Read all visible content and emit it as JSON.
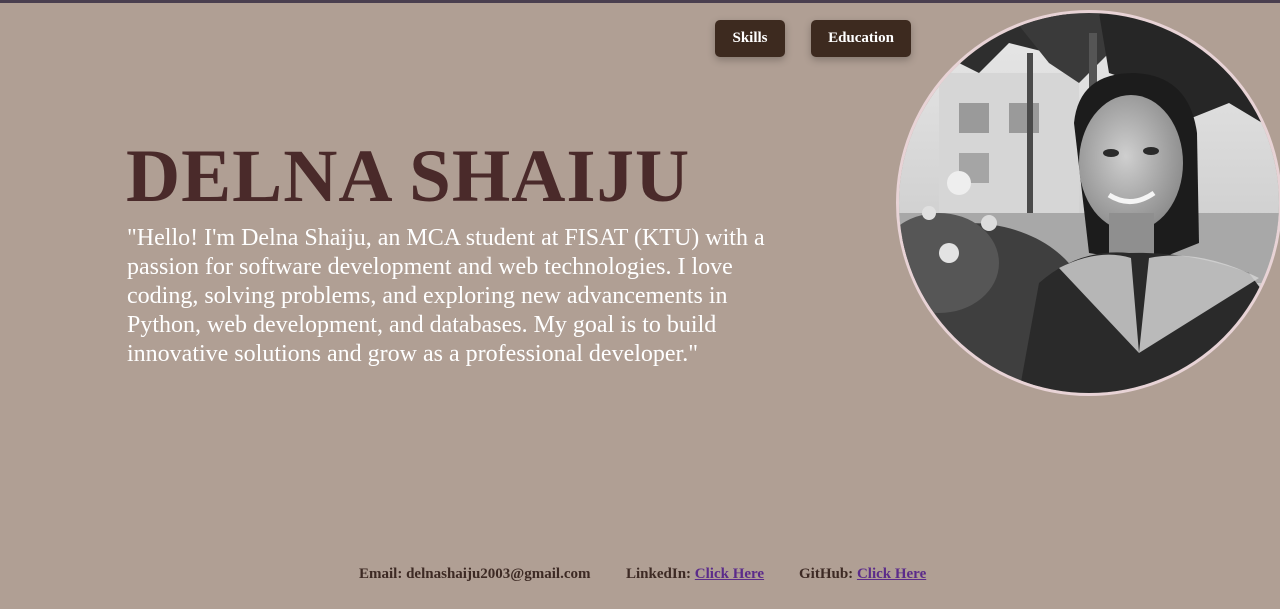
{
  "nav": {
    "skills_label": "Skills",
    "education_label": "Education"
  },
  "hero": {
    "name": "DELNA SHAIJU",
    "intro": "\"Hello! I'm Delna Shaiju, an MCA student at FISAT (KTU) with a passion for software development and web technologies. I love coding, solving problems, and exploring new advancements in Python, web development, and databases. My goal is to build innovative solutions and grow as a professional developer.\""
  },
  "profile_photo": {
    "icon": "profile-photo",
    "border_color": "#e8d3d6"
  },
  "footer": {
    "email_label": "Email:",
    "email_value": "delnashaiju2003@gmail.com",
    "linkedin_label": "LinkedIn:",
    "linkedin_link": "Click Here",
    "github_label": "GitHub:",
    "github_link": "Click Here"
  },
  "colors": {
    "background": "#b09f94",
    "button": "#3d2a1f",
    "name": "#4a2a2a",
    "link": "#5b2b8a",
    "top_border": "#4a3f4f"
  }
}
